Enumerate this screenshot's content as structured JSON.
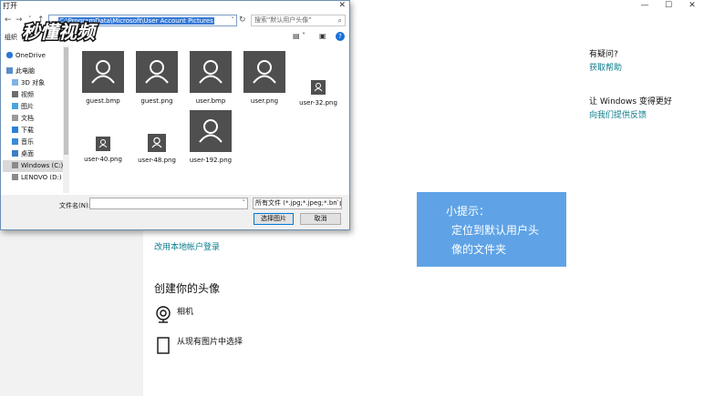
{
  "settings": {
    "window_controls": [
      "—",
      "☐",
      "✕"
    ],
    "help_title": "有疑问?",
    "help_link": "获取帮助",
    "improve_title": "让 Windows 变得更好",
    "improve_link": "向我们提供反馈",
    "local_account_link": "改用本地帐户登录",
    "create_title": "创建你的头像",
    "camera_label": "相机",
    "browse_label": "从现有图片中选择"
  },
  "tip": {
    "line1": "小提示：",
    "line2": "定位到默认用户头",
    "line3": "像的文件夹"
  },
  "dialog": {
    "title": "打开",
    "close": "✕",
    "address": "C:\\ProgramData\\Microsoft\\User Account Pictures",
    "search_placeholder": "搜索\"默认用户头像\"",
    "organize": "组织",
    "nav_items": [
      {
        "label": "OneDrive",
        "icon": "cloud-icon"
      },
      {
        "label": "此电脑",
        "icon": "computer-icon"
      },
      {
        "label": "3D 对象",
        "icon": "cube-icon"
      },
      {
        "label": "视频",
        "icon": "video-icon"
      },
      {
        "label": "图片",
        "icon": "picture-icon"
      },
      {
        "label": "文档",
        "icon": "document-icon"
      },
      {
        "label": "下载",
        "icon": "download-icon"
      },
      {
        "label": "音乐",
        "icon": "music-icon"
      },
      {
        "label": "桌面",
        "icon": "desktop-icon"
      },
      {
        "label": "Windows (C:)",
        "icon": "drive-icon"
      },
      {
        "label": "LENOVO (D:)",
        "icon": "drive-icon"
      }
    ],
    "files": [
      {
        "name": "guest.bmp",
        "size": "big"
      },
      {
        "name": "guest.png",
        "size": "big"
      },
      {
        "name": "user.bmp",
        "size": "big"
      },
      {
        "name": "user.png",
        "size": "big"
      },
      {
        "name": "user-32.png",
        "size": "small"
      },
      {
        "name": "user-40.png",
        "size": "small"
      },
      {
        "name": "user-48.png",
        "size": "small"
      },
      {
        "name": "user-192.png",
        "size": "big"
      }
    ],
    "filename_label": "文件名(N):",
    "filename_value": "",
    "filetype": "所有文件 (*.jpg;*.jpeg;*.bmp;",
    "open_button": "选择图片",
    "cancel_button": "取消"
  },
  "watermark": "秒懂视频",
  "colors": {
    "accent": "#0a7b8c",
    "tip_bg": "#5fa3e6",
    "selection": "#3478d6"
  }
}
